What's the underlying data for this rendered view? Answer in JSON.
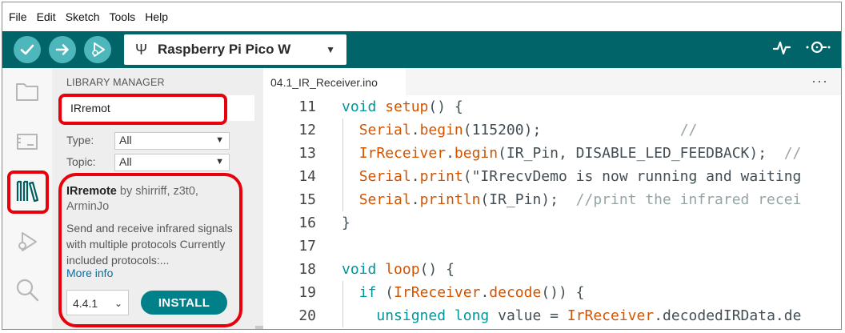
{
  "menu": [
    "File",
    "Edit",
    "Sketch",
    "Tools",
    "Help"
  ],
  "toolbar": {
    "board_name": "Raspberry Pi Pico W",
    "verify_icon": "check-icon",
    "upload_icon": "arrow-right-icon",
    "debug_icon": "debug-icon",
    "serial_plotter_icon": "pulse-icon",
    "serial_monitor_icon": "magnifier-dots-icon"
  },
  "library_manager": {
    "title": "LIBRARY MANAGER",
    "search_value": "IRremot",
    "type_label": "Type:",
    "type_value": "All",
    "topic_label": "Topic:",
    "topic_value": "All",
    "result": {
      "name": "IRremote",
      "by": " by shirriff, z3t0, ArminJo",
      "description": "Send and receive infrared signals with multiple protocols Currently included protocols:...",
      "more_info": "More info",
      "version": "4.4.1",
      "install_label": "INSTALL"
    }
  },
  "editor": {
    "tab_name": "04.1_IR_Receiver.ino",
    "more_label": "···",
    "lines": [
      {
        "n": "11",
        "code": "void setup() {"
      },
      {
        "n": "12",
        "code": "  Serial.begin(115200);                //"
      },
      {
        "n": "13",
        "code": "  IrReceiver.begin(IR_Pin, DISABLE_LED_FEEDBACK);  //"
      },
      {
        "n": "14",
        "code": "  Serial.print(\"IRrecvDemo is now running and waiting"
      },
      {
        "n": "15",
        "code": "  Serial.println(IR_Pin);  //print the infrared recei"
      },
      {
        "n": "16",
        "code": "}"
      },
      {
        "n": "17",
        "code": ""
      },
      {
        "n": "18",
        "code": "void loop() {"
      },
      {
        "n": "19",
        "code": "  if (IrReceiver.decode()) {"
      },
      {
        "n": "20",
        "code": "    unsigned long value = IrReceiver.decodedIRData.de"
      }
    ]
  },
  "colors": {
    "toolbar_bg": "#006468",
    "toolbar_button": "#4db7bb",
    "install_button": "#00818a",
    "highlight": "#e8000b",
    "keyword": "#00979c",
    "function": "#d35400",
    "comment": "#95a5a6"
  }
}
